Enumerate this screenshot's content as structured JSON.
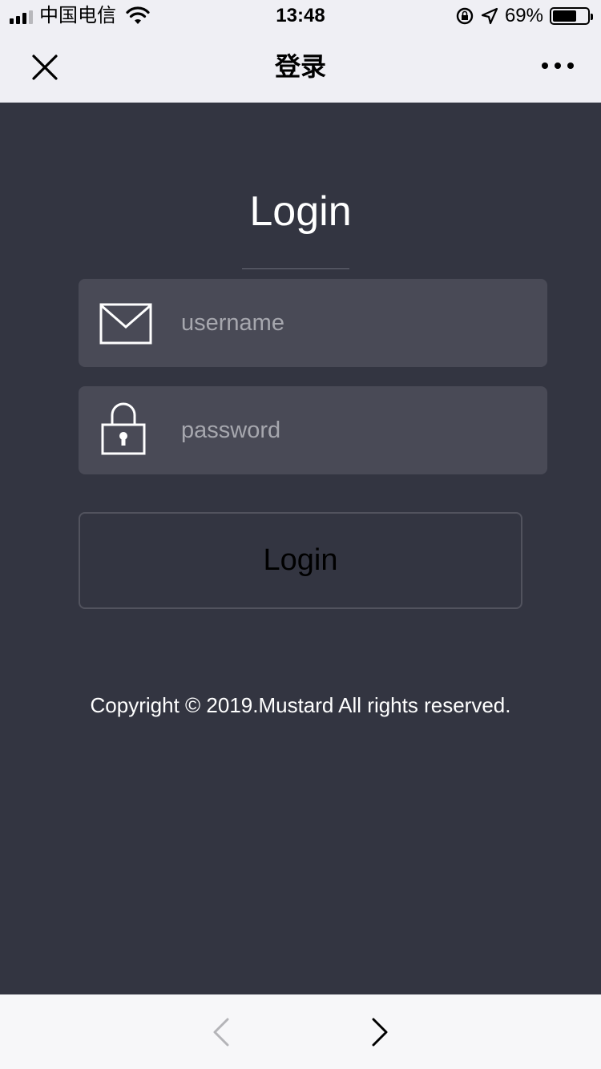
{
  "status_bar": {
    "carrier": "中国电信",
    "time": "13:48",
    "battery": "69%",
    "battery_level": 0.69
  },
  "nav": {
    "title": "登录",
    "close_icon": "close-icon",
    "more_icon": "more-icon"
  },
  "login": {
    "title": "Login",
    "username_placeholder": "username",
    "password_placeholder": "password",
    "username_icon": "envelope-icon",
    "password_icon": "lock-icon",
    "button_label": "Login",
    "copyright": "Copyright © 2019.Mustard All rights reserved."
  },
  "toolbar": {
    "back_icon": "chevron-left-icon",
    "forward_icon": "chevron-right-icon"
  },
  "colors": {
    "background": "#333541",
    "field_background": "#494a56",
    "nav_background": "#efeff4",
    "toolbar_background": "#f7f7f9"
  }
}
